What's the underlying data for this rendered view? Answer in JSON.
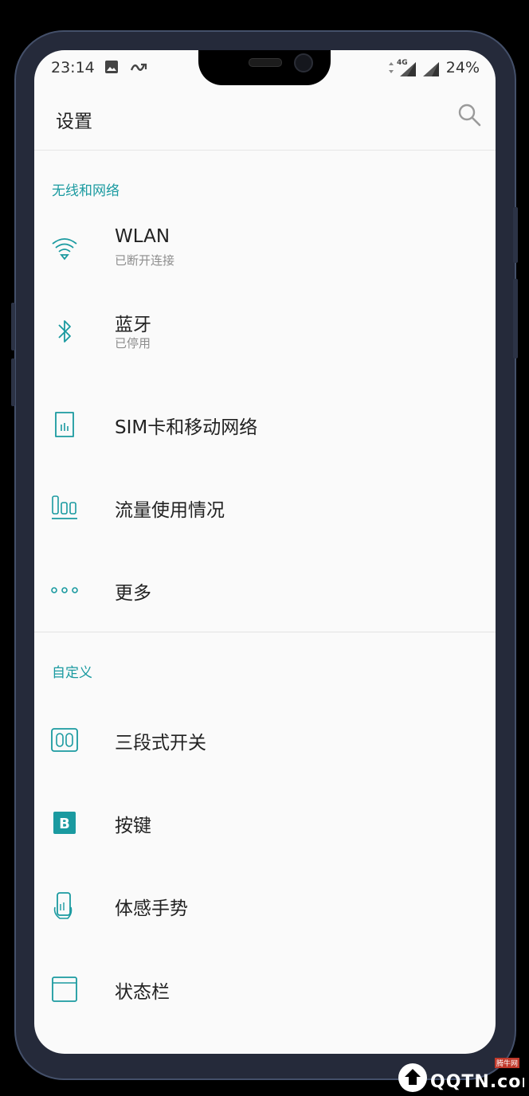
{
  "status_bar": {
    "time": "23:14",
    "network": "4G",
    "battery": "24%"
  },
  "header": {
    "title": "设置"
  },
  "sections": [
    {
      "header": "无线和网络",
      "items": [
        {
          "title": "WLAN",
          "subtitle": "已断开连接",
          "icon": "wifi-icon"
        },
        {
          "title": "蓝牙",
          "subtitle": "已停用",
          "icon": "bluetooth-icon"
        },
        {
          "title": "SIM卡和移动网络",
          "icon": "sim-card-icon"
        },
        {
          "title": "流量使用情况",
          "icon": "data-usage-icon"
        },
        {
          "title": "更多",
          "icon": "more-dots-icon"
        }
      ]
    },
    {
      "header": "自定义",
      "items": [
        {
          "title": "三段式开关",
          "icon": "alert-slider-icon"
        },
        {
          "title": "按键",
          "icon": "buttons-icon"
        },
        {
          "title": "体感手势",
          "icon": "gesture-icon"
        },
        {
          "title": "状态栏",
          "icon": "status-bar-icon"
        }
      ]
    }
  ],
  "watermark": {
    "brand": "QQTN.com",
    "site": "腾牛网"
  },
  "colors": {
    "accent": "#1a9aa0",
    "background": "#fafafa",
    "frame": "#252a3a"
  }
}
